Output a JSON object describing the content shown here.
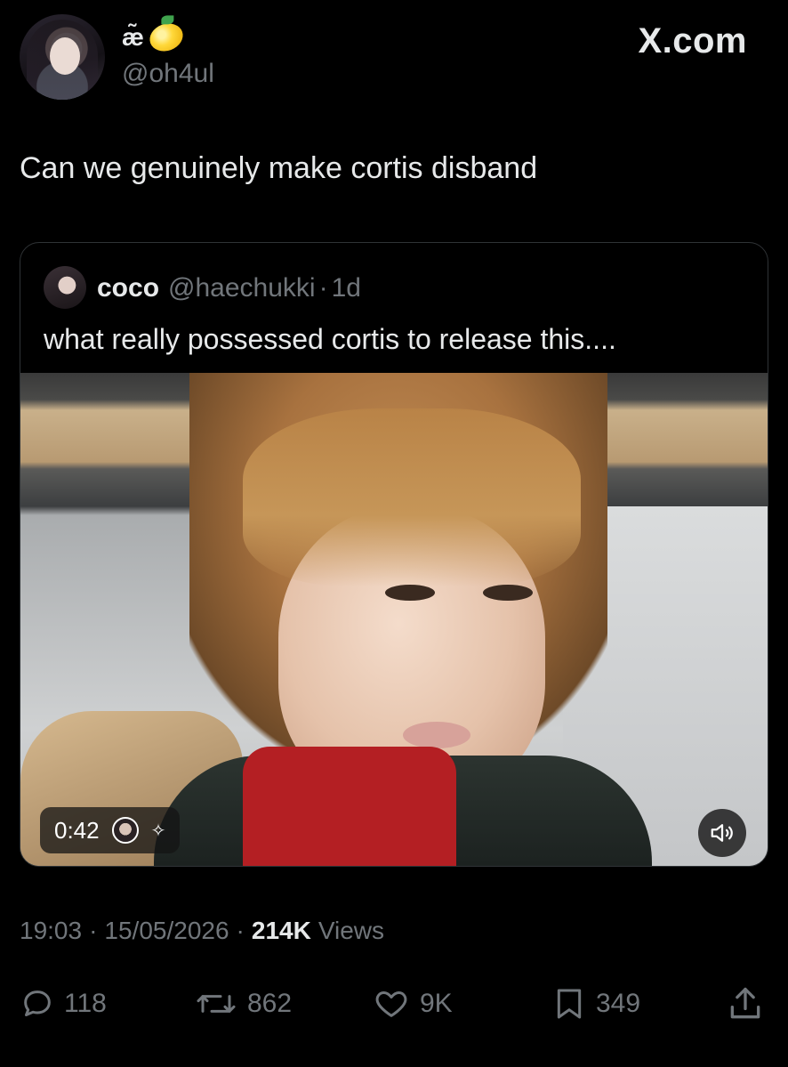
{
  "author": {
    "display_name": "æ̃",
    "handle": "@oh4ul"
  },
  "watermark": "X.com",
  "tweet": {
    "text": "Can we genuinely make cortis disband"
  },
  "quoted": {
    "name": "coco",
    "handle": "@haechukki",
    "separator": "·",
    "age": "1d",
    "text": "what really possessed cortis to release this....",
    "video": {
      "duration": "0:42"
    }
  },
  "meta": {
    "time": "19:03",
    "sep1": "·",
    "date": "15/05/2026",
    "sep2": "·",
    "views_count": "214K",
    "views_label": "Views"
  },
  "actions": {
    "replies": "118",
    "reposts": "862",
    "likes": "9K",
    "bookmarks": "349"
  },
  "icons": {
    "reply": "reply-icon",
    "repost": "repost-icon",
    "like": "heart-icon",
    "bookmark": "bookmark-icon",
    "share": "share-icon",
    "sound": "speaker-icon",
    "emoji": "lemon-emoji"
  }
}
